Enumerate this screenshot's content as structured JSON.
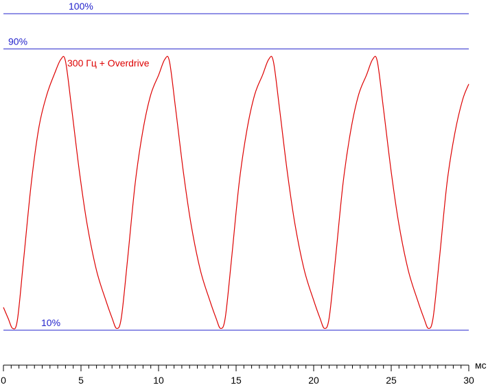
{
  "chart_data": {
    "type": "line",
    "title": "",
    "xlabel": "",
    "ylabel": "",
    "x_unit": "мс",
    "xlim": [
      0,
      30
    ],
    "ylim": [
      0,
      100
    ],
    "x_ticks": [
      0,
      5,
      10,
      15,
      20,
      25,
      30
    ],
    "x_minor_step": 0.5,
    "grid": false,
    "reference_lines": [
      {
        "label": "100%",
        "value": 100
      },
      {
        "label": "90%",
        "value": 90
      },
      {
        "label": "10%",
        "value": 10
      }
    ],
    "series": [
      {
        "name": "300 Гц + Overdrive",
        "color": "#dd0000",
        "points": [
          [
            0.0,
            16.5
          ],
          [
            0.3,
            13.4
          ],
          [
            0.6,
            10.5
          ],
          [
            0.9,
            12.9
          ],
          [
            1.3,
            30.0
          ],
          [
            1.8,
            52.0
          ],
          [
            2.3,
            68.0
          ],
          [
            2.8,
            77.0
          ],
          [
            3.3,
            83.0
          ],
          [
            3.7,
            87.0
          ],
          [
            4.0,
            86.5
          ],
          [
            4.4,
            73.0
          ],
          [
            4.9,
            55.0
          ],
          [
            5.4,
            40.0
          ],
          [
            6.0,
            27.0
          ],
          [
            6.6,
            18.5
          ],
          [
            7.0,
            13.5
          ],
          [
            7.3,
            10.5
          ],
          [
            7.6,
            13.5
          ],
          [
            8.0,
            30.0
          ],
          [
            8.5,
            52.0
          ],
          [
            9.0,
            67.0
          ],
          [
            9.5,
            77.0
          ],
          [
            10.0,
            82.5
          ],
          [
            10.4,
            87.0
          ],
          [
            10.7,
            86.5
          ],
          [
            11.1,
            73.0
          ],
          [
            11.6,
            55.0
          ],
          [
            12.1,
            40.0
          ],
          [
            12.7,
            27.0
          ],
          [
            13.3,
            18.5
          ],
          [
            13.7,
            13.5
          ],
          [
            14.0,
            10.5
          ],
          [
            14.3,
            13.5
          ],
          [
            14.7,
            30.0
          ],
          [
            15.2,
            52.0
          ],
          [
            15.7,
            67.0
          ],
          [
            16.2,
            77.0
          ],
          [
            16.7,
            82.5
          ],
          [
            17.1,
            87.0
          ],
          [
            17.4,
            86.5
          ],
          [
            17.8,
            73.0
          ],
          [
            18.3,
            55.0
          ],
          [
            18.8,
            40.0
          ],
          [
            19.4,
            27.0
          ],
          [
            20.0,
            18.5
          ],
          [
            20.4,
            13.5
          ],
          [
            20.7,
            10.5
          ],
          [
            21.0,
            13.5
          ],
          [
            21.4,
            30.0
          ],
          [
            21.9,
            52.0
          ],
          [
            22.4,
            67.0
          ],
          [
            22.9,
            77.0
          ],
          [
            23.4,
            82.5
          ],
          [
            23.8,
            87.0
          ],
          [
            24.1,
            86.5
          ],
          [
            24.5,
            73.0
          ],
          [
            25.0,
            55.0
          ],
          [
            25.5,
            40.0
          ],
          [
            26.1,
            27.0
          ],
          [
            26.7,
            18.5
          ],
          [
            27.1,
            13.5
          ],
          [
            27.4,
            10.5
          ],
          [
            27.7,
            13.5
          ],
          [
            28.1,
            30.0
          ],
          [
            28.6,
            52.0
          ],
          [
            29.1,
            66.0
          ],
          [
            29.6,
            75.5
          ],
          [
            30.0,
            80.0
          ]
        ]
      }
    ]
  }
}
